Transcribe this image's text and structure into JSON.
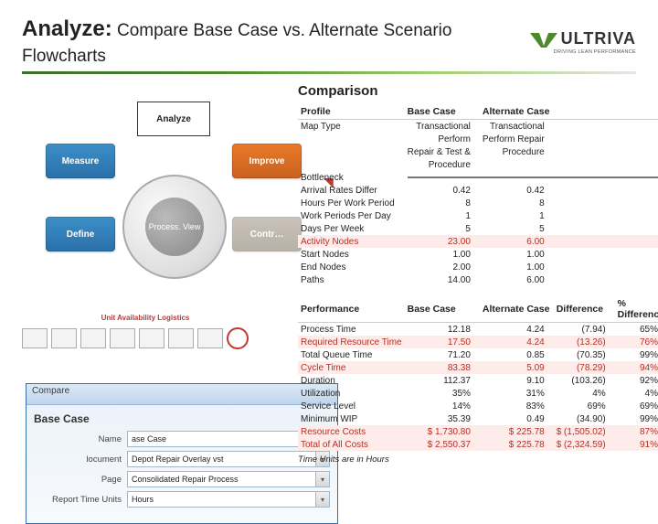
{
  "title": {
    "strong": "Analyze:",
    "rest": " Compare Base Case vs. Alternate Scenario Flowcharts"
  },
  "logo": {
    "name": "ULTRIVA",
    "tagline": "DRIVING LEAN PERFORMANCE"
  },
  "dmaic": {
    "analyze": "Analyze",
    "measure": "Measure",
    "improve": "Improve",
    "define": "Define",
    "control": "Contr…",
    "center": "Process. View"
  },
  "flowchart": {
    "title": "Unit Availability Logistics"
  },
  "dialog": {
    "title": "Compare",
    "section": "Base Case",
    "rows": {
      "name": {
        "label": "Name",
        "value": "ase Case"
      },
      "document": {
        "label": "locument",
        "value": "Depot Repair Overlay vst"
      },
      "page": {
        "label": "Page",
        "value": "Consolidated Repair Process"
      },
      "units": {
        "label": "Report Time Units",
        "value": "Hours"
      }
    }
  },
  "comparison": {
    "heading": "Comparison",
    "profile": {
      "title": "Profile",
      "cols": [
        "Base Case",
        "Alternate Case"
      ],
      "maptype": {
        "label": "Map Type",
        "base": "Transactional",
        "alt": "Transactional"
      },
      "perform1": {
        "base": "Perform",
        "alt": "Perform Repair"
      },
      "perform2": {
        "base": "Repair & Test &",
        "alt": "Procedure"
      },
      "perform3": {
        "base": "Procedure",
        "alt": ""
      },
      "bottleneck": "Bottleneck",
      "rows": [
        {
          "label": "Arrival Rates Differ",
          "base": "0.42",
          "alt": "0.42"
        },
        {
          "label": "Hours Per Work Period",
          "base": "8",
          "alt": "8"
        },
        {
          "label": "Work Periods Per Day",
          "base": "1",
          "alt": "1"
        },
        {
          "label": "Days Per Week",
          "base": "5",
          "alt": "5"
        },
        {
          "label": "Activity Nodes",
          "base": "23.00",
          "alt": "6.00",
          "hl": true
        },
        {
          "label": "Start Nodes",
          "base": "1.00",
          "alt": "1.00"
        },
        {
          "label": "End Nodes",
          "base": "2.00",
          "alt": "1.00"
        },
        {
          "label": "Paths",
          "base": "14.00",
          "alt": "6.00"
        }
      ]
    },
    "performance": {
      "title": "Performance",
      "cols": [
        "Base Case",
        "Alternate Case",
        "Difference",
        "% Difference"
      ],
      "rows": [
        {
          "label": "Process Time",
          "base": "12.18",
          "alt": "4.24",
          "diff": "(7.94)",
          "pct": "65%"
        },
        {
          "label": "Required Resource Time",
          "base": "17.50",
          "alt": "4.24",
          "diff": "(13.26)",
          "pct": "76%",
          "hl": true
        },
        {
          "label": "Total Queue Time",
          "base": "71.20",
          "alt": "0.85",
          "diff": "(70.35)",
          "pct": "99%"
        },
        {
          "label": "Cycle Time",
          "base": "83.38",
          "alt": "5.09",
          "diff": "(78.29)",
          "pct": "94%",
          "hl": true
        },
        {
          "label": "Duration",
          "base": "112.37",
          "alt": "9.10",
          "diff": "(103.26)",
          "pct": "92%"
        },
        {
          "label": "Utilization",
          "base": "35%",
          "alt": "31%",
          "diff": "4%",
          "pct": "4%"
        },
        {
          "label": "Service Level",
          "base": "14%",
          "alt": "83%",
          "diff": "69%",
          "pct": "69%"
        },
        {
          "label": "Minimum WIP",
          "base": "35.39",
          "alt": "0.49",
          "diff": "(34.90)",
          "pct": "99%"
        },
        {
          "label": "Resource Costs",
          "base": "$   1,730.80",
          "alt": "$   225.78",
          "diff": "$ (1,505.02)",
          "pct": "87%",
          "hl": true
        },
        {
          "label": "Total of All Costs",
          "base": "$   2,550.37",
          "alt": "$   225.78",
          "diff": "$ (2,324.59)",
          "pct": "91%",
          "hl": true
        }
      ]
    },
    "footnote": "Time Units are in Hours"
  }
}
